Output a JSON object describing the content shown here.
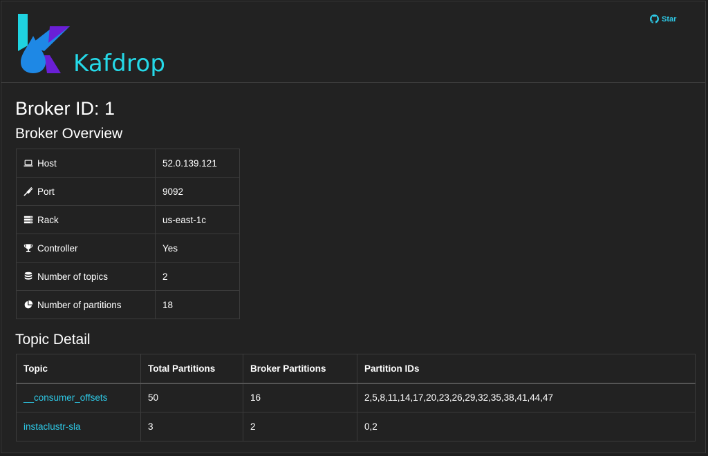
{
  "colors": {
    "background": "#222222",
    "accent": "#25d9e8",
    "link": "#2ec9e6",
    "logo_cyan": "#1fd3e0",
    "logo_blue": "#1e88e5",
    "logo_purple": "#6a1fd6"
  },
  "header": {
    "brand": "Kafdrop",
    "star_label": "Star",
    "star_icon": "github-icon"
  },
  "page": {
    "title": "Broker ID: 1"
  },
  "overview": {
    "title": "Broker Overview",
    "rows": [
      {
        "icon": "laptop-icon",
        "label": "Host",
        "value": "52.0.139.121"
      },
      {
        "icon": "plug-icon",
        "label": "Port",
        "value": "9092"
      },
      {
        "icon": "server-icon",
        "label": "Rack",
        "value": "us-east-1c"
      },
      {
        "icon": "trophy-icon",
        "label": "Controller",
        "value": "Yes"
      },
      {
        "icon": "database-icon",
        "label": "Number of topics",
        "value": "2"
      },
      {
        "icon": "pie-chart-icon",
        "label": "Number of partitions",
        "value": "18"
      }
    ]
  },
  "topics": {
    "title": "Topic Detail",
    "columns": [
      "Topic",
      "Total Partitions",
      "Broker Partitions",
      "Partition IDs"
    ],
    "rows": [
      {
        "topic": "__consumer_offsets",
        "total": "50",
        "broker": "16",
        "ids": "2,5,8,11,14,17,20,23,26,29,32,35,38,41,44,47"
      },
      {
        "topic": "instaclustr-sla",
        "total": "3",
        "broker": "2",
        "ids": "0,2"
      }
    ]
  }
}
